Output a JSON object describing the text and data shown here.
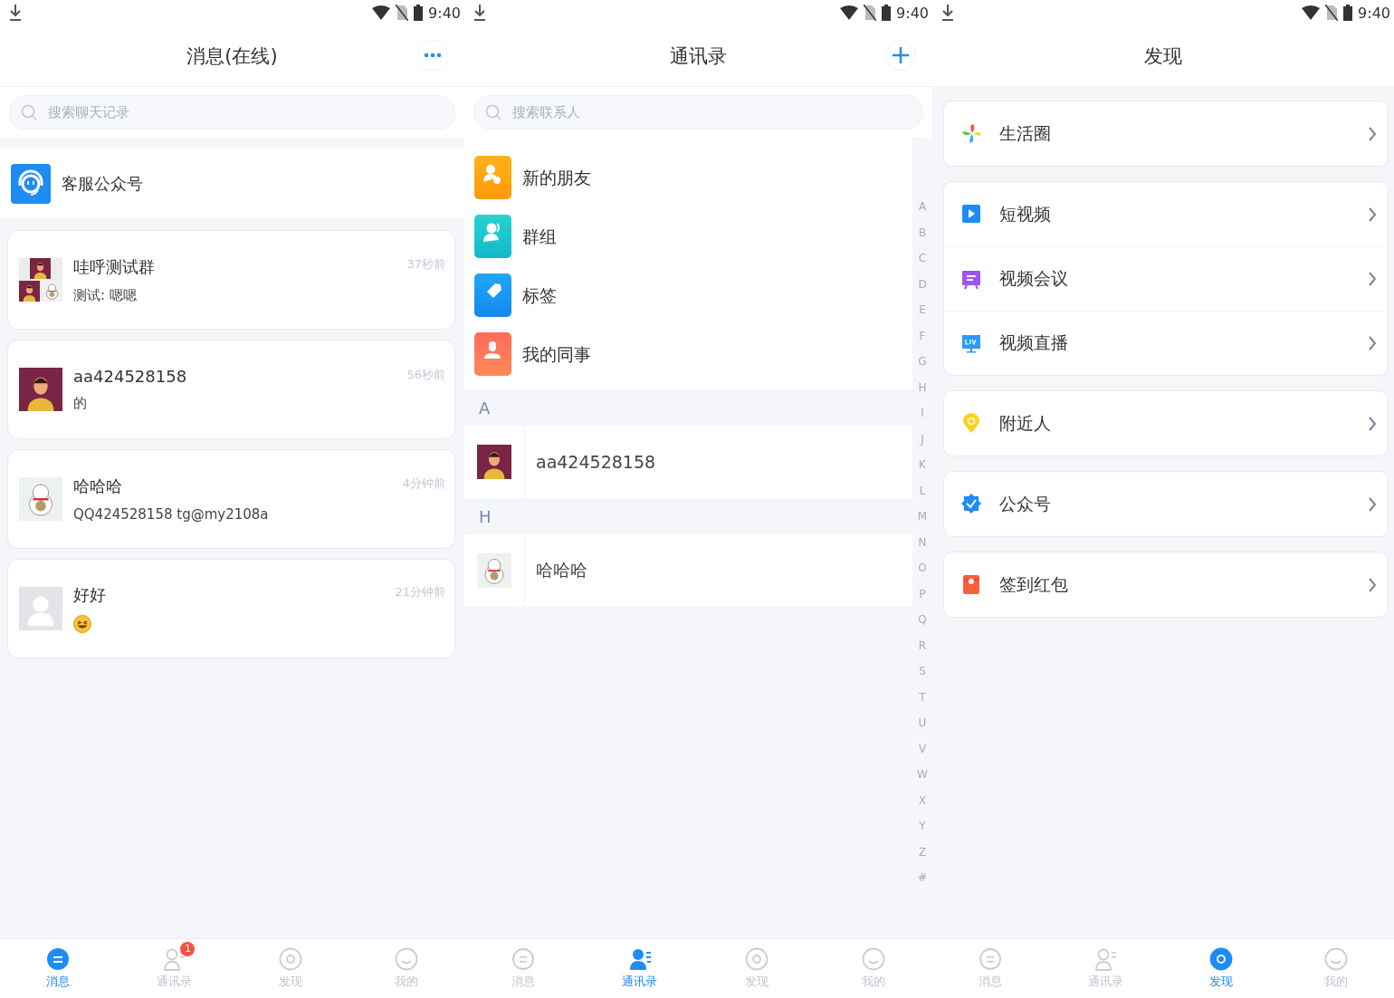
{
  "screens": [
    {
      "kind": "messages",
      "status_bar": {
        "time": "9:40"
      },
      "header": {
        "title": "消息(在线)",
        "action": {
          "kind": "more"
        }
      },
      "search": {
        "placeholder": "搜索聊天记录"
      },
      "pinned": {
        "name": "客服公众号"
      },
      "conversations": [
        {
          "name": "哇呼测试群",
          "preview": "测试: 嗯嗯",
          "time": "37秒前",
          "avatar": {
            "kind": "group"
          }
        },
        {
          "name": "aa424528158",
          "preview": "的",
          "time": "56秒前",
          "avatar": {
            "kind": "man"
          }
        },
        {
          "name": "哈哈哈",
          "preview": "QQ424528158 tg@my2108a",
          "time": "4分钟前",
          "avatar": {
            "kind": "cat"
          }
        },
        {
          "name": "好好",
          "preview_icon": {
            "kind": "grin"
          },
          "time": "21分钟前",
          "avatar": {
            "kind": "blank"
          }
        }
      ],
      "tab_bar": [
        {
          "label": "消息",
          "kind": "chat",
          "selected": true
        },
        {
          "label": "通讯录",
          "kind": "contacts",
          "selected": false,
          "badge": "1"
        },
        {
          "label": "发现",
          "kind": "discover",
          "selected": false
        },
        {
          "label": "我的",
          "kind": "me",
          "selected": false
        }
      ]
    },
    {
      "kind": "contacts",
      "status_bar": {
        "time": "9:40"
      },
      "header": {
        "title": "通讯录",
        "action": {
          "kind": "add"
        }
      },
      "search": {
        "placeholder": "搜索联系人"
      },
      "functions": [
        {
          "label": "新的朋友",
          "kind": "new-friend"
        },
        {
          "label": "群组",
          "kind": "group"
        },
        {
          "label": "标签",
          "kind": "tag"
        },
        {
          "label": "我的同事",
          "kind": "colleague"
        }
      ],
      "sections": [
        {
          "letter": "A",
          "contacts": [
            {
              "name": "aa424528158",
              "avatar": {
                "kind": "man"
              }
            }
          ]
        },
        {
          "letter": "H",
          "contacts": [
            {
              "name": "哈哈哈",
              "avatar": {
                "kind": "cat"
              }
            }
          ]
        }
      ],
      "index": [
        "A",
        "B",
        "C",
        "D",
        "E",
        "F",
        "G",
        "H",
        "I",
        "J",
        "K",
        "L",
        "M",
        "N",
        "O",
        "P",
        "Q",
        "R",
        "S",
        "T",
        "U",
        "V",
        "W",
        "X",
        "Y",
        "Z",
        "#"
      ],
      "tab_bar": [
        {
          "label": "消息",
          "kind": "chat",
          "selected": false
        },
        {
          "label": "通讯录",
          "kind": "contacts",
          "selected": true
        },
        {
          "label": "发现",
          "kind": "discover",
          "selected": false
        },
        {
          "label": "我的",
          "kind": "me",
          "selected": false
        }
      ]
    },
    {
      "kind": "discover",
      "status_bar": {
        "time": "9:40"
      },
      "header": {
        "title": "发现"
      },
      "groups": [
        [
          {
            "label": "生活圈",
            "kind": "pinwheel"
          }
        ],
        [
          {
            "label": "短视频",
            "kind": "play"
          },
          {
            "label": "视频会议",
            "kind": "meeting"
          },
          {
            "label": "视频直播",
            "kind": "live"
          }
        ],
        [
          {
            "label": "附近人",
            "kind": "pin"
          }
        ],
        [
          {
            "label": "公众号",
            "kind": "badge"
          }
        ],
        [
          {
            "label": "签到红包",
            "kind": "envelope"
          }
        ]
      ],
      "tab_bar": [
        {
          "label": "消息",
          "kind": "chat",
          "selected": false
        },
        {
          "label": "通讯录",
          "kind": "contacts",
          "selected": false
        },
        {
          "label": "发现",
          "kind": "discover",
          "selected": true
        },
        {
          "label": "我的",
          "kind": "me",
          "selected": false
        }
      ]
    }
  ]
}
